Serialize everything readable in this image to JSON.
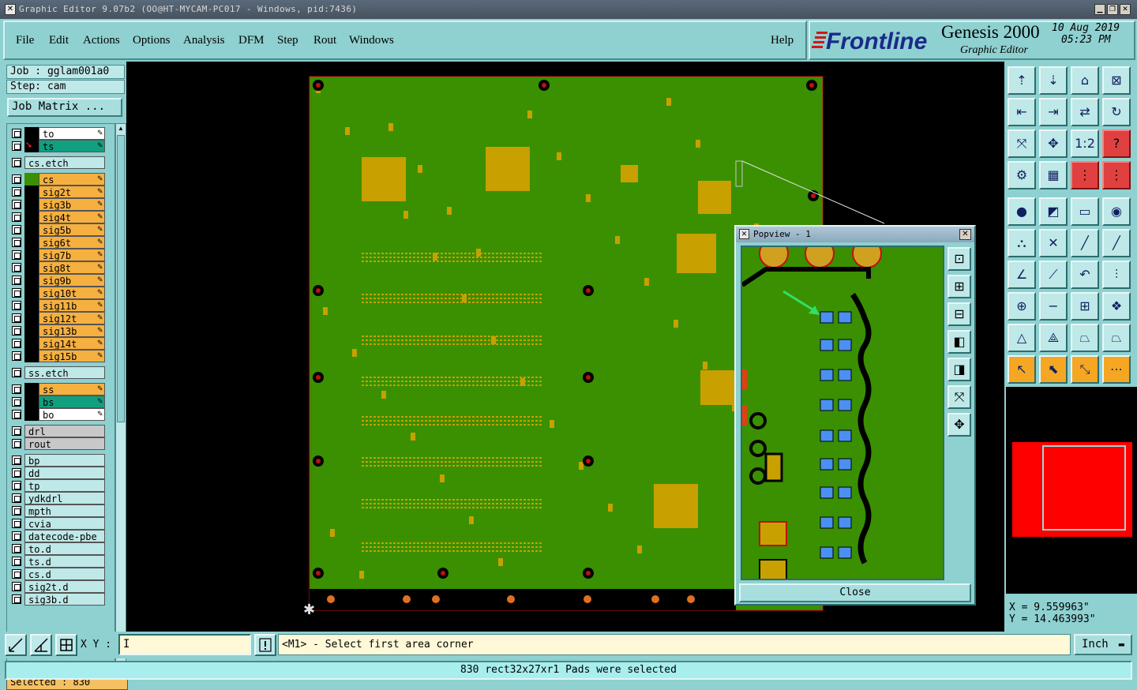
{
  "window": {
    "title": "Graphic Editor 9.07b2 (OO@HT-MYCAM-PC017 - Windows, pid:7436)",
    "controls": [
      "minimize-icon",
      "maximize-icon",
      "close-icon"
    ]
  },
  "menu": {
    "items": [
      "File",
      "Edit",
      "Actions",
      "Options",
      "Analysis",
      "DFM",
      "Step",
      "Rout",
      "Windows"
    ],
    "help": "Help"
  },
  "brand": {
    "logo": "Frontline",
    "product": "Genesis 2000",
    "subtitle": "Graphic Editor",
    "date": "10 Aug 2019",
    "time": "05:23 PM",
    "accent_color": "#d01818"
  },
  "job": {
    "job_line": "Job : gglam001a0",
    "step_line": "Step: cam",
    "matrix_button": "Job Matrix ..."
  },
  "layers": [
    {
      "name": "to",
      "color": "#ffffff",
      "swatch": "#000000",
      "active": false
    },
    {
      "name": "ts",
      "color": "#10a080",
      "swatch": "#000000",
      "active": true
    },
    {
      "name": "cs.etch",
      "color": "#bfe8e8",
      "swatch": "",
      "active": false
    },
    {
      "name": "cs",
      "color": "#f5b040",
      "swatch": "#3a9000",
      "active": false
    },
    {
      "name": "sig2t",
      "color": "#f5b040",
      "swatch": "#000000",
      "active": false
    },
    {
      "name": "sig3b",
      "color": "#f5b040",
      "swatch": "#000000",
      "active": false
    },
    {
      "name": "sig4t",
      "color": "#f5b040",
      "swatch": "#000000",
      "active": false
    },
    {
      "name": "sig5b",
      "color": "#f5b040",
      "swatch": "#000000",
      "active": false
    },
    {
      "name": "sig6t",
      "color": "#f5b040",
      "swatch": "#000000",
      "active": false
    },
    {
      "name": "sig7b",
      "color": "#f5b040",
      "swatch": "#000000",
      "active": false
    },
    {
      "name": "sig8t",
      "color": "#f5b040",
      "swatch": "#000000",
      "active": false
    },
    {
      "name": "sig9b",
      "color": "#f5b040",
      "swatch": "#000000",
      "active": false
    },
    {
      "name": "sig10t",
      "color": "#f5b040",
      "swatch": "#000000",
      "active": false
    },
    {
      "name": "sig11b",
      "color": "#f5b040",
      "swatch": "#000000",
      "active": false
    },
    {
      "name": "sig12t",
      "color": "#f5b040",
      "swatch": "#000000",
      "active": false
    },
    {
      "name": "sig13b",
      "color": "#f5b040",
      "swatch": "#000000",
      "active": false
    },
    {
      "name": "sig14t",
      "color": "#f5b040",
      "swatch": "#000000",
      "active": false
    },
    {
      "name": "sig15b",
      "color": "#f5b040",
      "swatch": "#000000",
      "active": false
    },
    {
      "name": "ss.etch",
      "color": "#bfe8e8",
      "swatch": "",
      "active": false
    },
    {
      "name": "ss",
      "color": "#f5b040",
      "swatch": "#000000",
      "active": false
    },
    {
      "name": "bs",
      "color": "#10a080",
      "swatch": "#000000",
      "active": false
    },
    {
      "name": "bo",
      "color": "#ffffff",
      "swatch": "#000000",
      "active": false
    },
    {
      "name": "drl",
      "color": "#c8c8c8",
      "swatch": "",
      "active": false
    },
    {
      "name": "rout",
      "color": "#c8c8c8",
      "swatch": "",
      "active": false
    },
    {
      "name": "bp",
      "color": "#bfe8e8",
      "swatch": "",
      "active": false
    },
    {
      "name": "dd",
      "color": "#bfe8e8",
      "swatch": "",
      "active": false
    },
    {
      "name": "tp",
      "color": "#bfe8e8",
      "swatch": "",
      "active": false
    },
    {
      "name": "ydkdrl",
      "color": "#bfe8e8",
      "swatch": "",
      "active": false
    },
    {
      "name": "mpth",
      "color": "#bfe8e8",
      "swatch": "",
      "active": false
    },
    {
      "name": "cvia",
      "color": "#bfe8e8",
      "swatch": "",
      "active": false
    },
    {
      "name": "datecode-pbe",
      "color": "#bfe8e8",
      "swatch": "",
      "active": false
    },
    {
      "name": "to.d",
      "color": "#bfe8e8",
      "swatch": "",
      "active": false
    },
    {
      "name": "ts.d",
      "color": "#bfe8e8",
      "swatch": "",
      "active": false
    },
    {
      "name": "cs.d",
      "color": "#bfe8e8",
      "swatch": "",
      "active": false
    },
    {
      "name": "sig2t.d",
      "color": "#bfe8e8",
      "swatch": "",
      "active": false
    },
    {
      "name": "sig3b.d",
      "color": "#bfe8e8",
      "swatch": "",
      "active": false
    }
  ],
  "selection": {
    "count_label": "Selected : 830"
  },
  "popview": {
    "title": "Popview - 1",
    "close_button": "Close"
  },
  "coordinates": {
    "x": "X = 9.559963\"",
    "y": "Y = 14.463993\""
  },
  "bottom": {
    "xy_label": "X Y :",
    "xy_value": "",
    "prompt": "<M1> - Select first area corner",
    "unit": "Inch",
    "status": "830 rect32x27xr1 Pads were selected"
  },
  "colors": {
    "board": "#3a9000",
    "copper": "#c8a000",
    "background": "#8fd0d0",
    "outline": "#d01818",
    "selected_pad": "#4a90f0"
  }
}
